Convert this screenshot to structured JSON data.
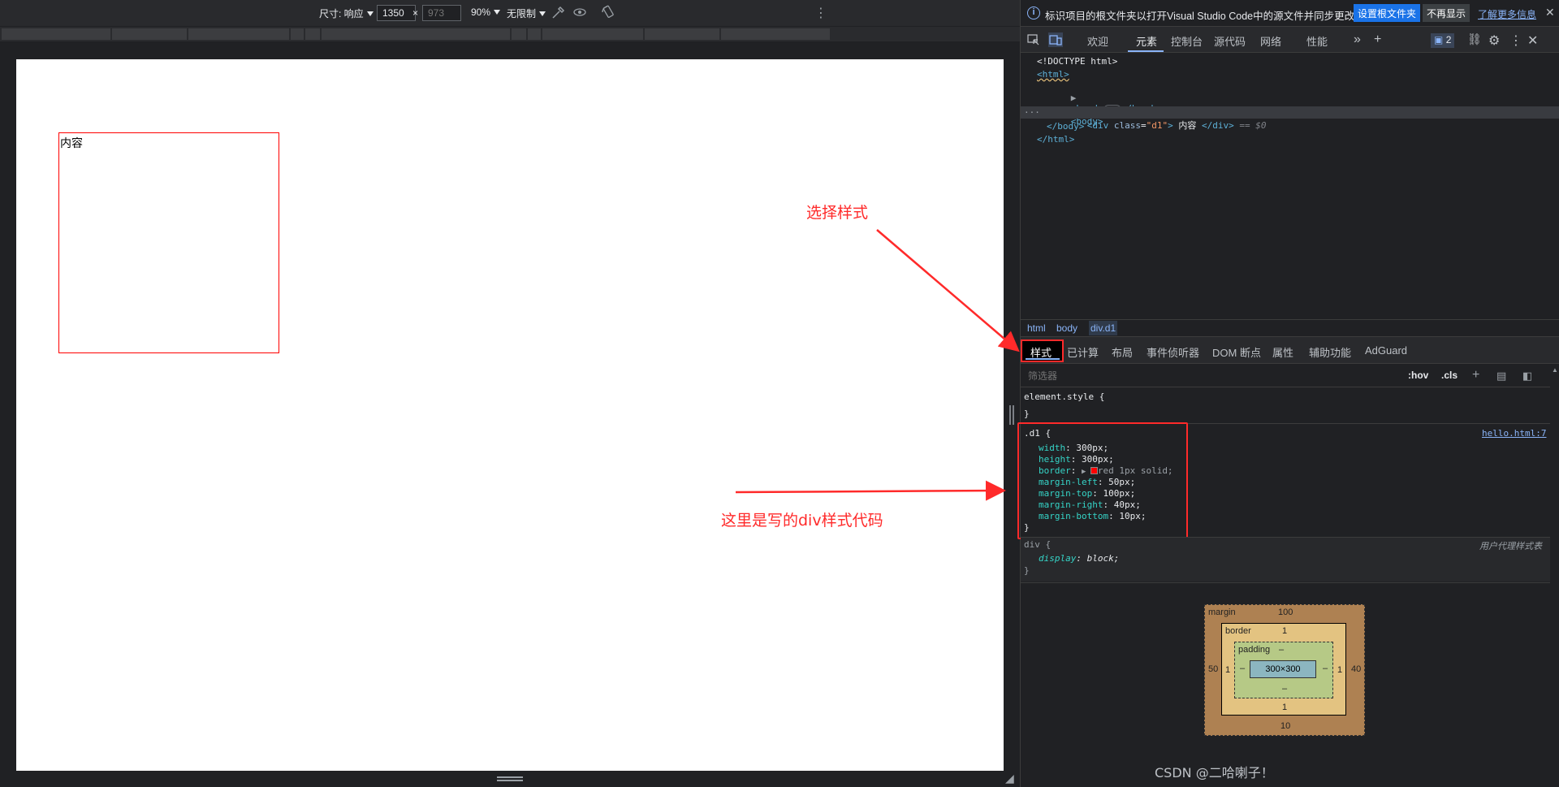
{
  "device_toolbar": {
    "dimensions_label": "尺寸: 响应",
    "width_value": "1350",
    "height_placeholder": "973",
    "x_sep": "×",
    "zoom": "90%",
    "throttle": "无限制"
  },
  "viewport": {
    "div_text": "内容"
  },
  "annotations": {
    "choose_style": "选择样式",
    "div_code_note": "这里是写的div样式代码"
  },
  "devtools": {
    "infobar": {
      "message": "标识项目的根文件夹以打开Visual Studio Code中的源文件并同步更改。",
      "set_root_button": "设置根文件夹",
      "dont_show_button": "不再显示",
      "learn_more_link": "了解更多信息"
    },
    "tabs": [
      "欢迎",
      "元素",
      "控制台",
      "源代码",
      "网络",
      "性能"
    ],
    "issues_count": "2",
    "tree": {
      "doctype": "<!DOCTYPE html>",
      "html_open": "<html>",
      "head": "<head>",
      "head_close": "</head>",
      "body_open": "<body>",
      "div_open": "<div",
      "div_attr_name": "class",
      "div_attr_value": "\"d1\"",
      "div_gt": ">",
      "div_text": " 内容 ",
      "div_close": "</div>",
      "div_eq": "== $0",
      "body_close": "</body>",
      "html_close": "</html>"
    },
    "breadcrumbs": [
      "html",
      "body",
      "div.d1"
    ],
    "subtabs": [
      "样式",
      "已计算",
      "布局",
      "事件侦听器",
      "DOM 断点",
      "属性",
      "辅助功能",
      "AdGuard"
    ],
    "filter_placeholder": "筛选器",
    "filter_hov": ":hov",
    "filter_cls": ".cls",
    "styles": {
      "element_style_open": "element.style {",
      "close_brace": "}",
      "d1_selector": ".d1 {",
      "d1_source": "hello.html:7",
      "d1_props": [
        {
          "name": "width",
          "value": "300px;"
        },
        {
          "name": "height",
          "value": "300px;"
        },
        {
          "name": "border",
          "value": "red 1px solid;"
        },
        {
          "name": "margin-left",
          "value": "50px;"
        },
        {
          "name": "margin-top",
          "value": "100px;"
        },
        {
          "name": "margin-right",
          "value": "40px;"
        },
        {
          "name": "margin-bottom",
          "value": "10px;"
        }
      ],
      "div_selector": "div {",
      "div_source": "用户代理样式表",
      "div_prop_name": "display",
      "div_prop_value": "block;"
    },
    "box_model": {
      "margin_label": "margin",
      "margin_top": "100",
      "margin_left": "50",
      "margin_right": "40",
      "margin_bottom": "10",
      "border_label": "border",
      "border_top": "1",
      "border_left": "1",
      "border_right": "1",
      "border_bottom": "1",
      "padding_label": "padding",
      "padding_top": "–",
      "padding_left": "–",
      "padding_right": "–",
      "padding_bottom": "–",
      "content": "300×300"
    }
  },
  "watermark": "CSDN @二哈喇子！",
  "colors": {
    "annotation_red": "#ff2a2a",
    "accent_blue": "#1a73e8",
    "devtools_bg": "#202124"
  }
}
